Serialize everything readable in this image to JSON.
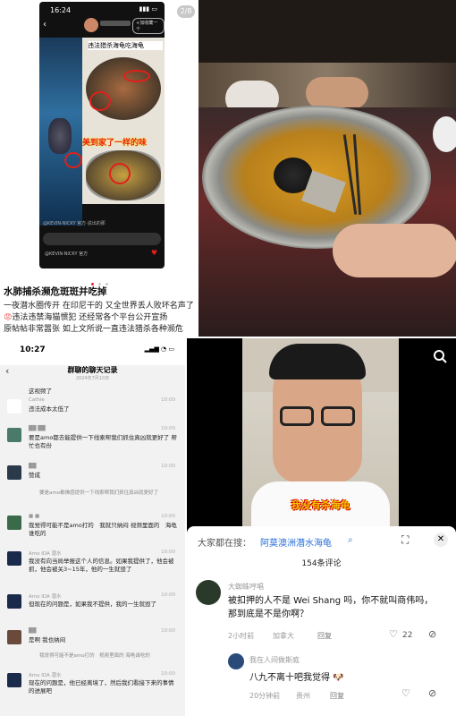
{
  "panel_a": {
    "status_time": "16:24",
    "page_indicator": "2/8",
    "post_header_tag": "+加收藏一个",
    "overlay_title": "违法猎杀海龟吃海龟",
    "overlay_caption": "美到家了一样的味",
    "username": "@KEVIN·NICKY 官方·说出的那",
    "username2": "@KEVIN·NICKY 官方",
    "article_title": "水肺捕杀濒危斑斑并吃掉",
    "article_body_1": "一夜潜水圈传开 在印尼干的 又全世界丢人败坏名声了",
    "article_body_2": "违法违禁海猫惯犯 还经常各个平台公开宣扬",
    "article_body_3": "原帖帖非常嚣张 如上文所说一直违法猎杀各种濒危"
  },
  "panel_c": {
    "time": "10:27",
    "nav_title": "群聊的聊天记录",
    "nav_subtitle": "2024年7月10日",
    "messages": [
      {
        "name": "",
        "time": "",
        "text": "这视频了"
      },
      {
        "name": "Cathie",
        "time": "10:00",
        "text": "违法成本太低了"
      },
      {
        "name": "",
        "time": "10:00",
        "text": "要是amo都去能提供一下线索帮我们抓住真凶就更好了 帮忙也有份"
      },
      {
        "name": "",
        "time": "10:00",
        "text": "赞成"
      },
      {
        "name": "",
        "time": "10:00",
        "text": "要是amo都佛感提供一下线索帮我们抓住真凶就更好了"
      },
      {
        "name": "",
        "time": "10:00",
        "text": "我觉得可能不是amo打的　我就只纳闷 视频里面的　海龟谁吃的"
      },
      {
        "name": "Amo IDA 潜水",
        "time": "10:00",
        "text": "我没有向当局举报这个人的信息。如果我提供了，他会被抓，他会被关3~15年，他的一生就毁了"
      },
      {
        "name": "Amo IDA 潜水",
        "time": "10:00",
        "text": "但现在的问题是，如果我不提供，我的一生就毁了"
      },
      {
        "name": "",
        "time": "10:00",
        "text": "是啊 我也纳闷"
      },
      {
        "name": "",
        "time": "10:00",
        "text": "我觉得可能不是amo打的　视频里面的 海龟谁吃的"
      },
      {
        "name": "Amo IDA 潜水",
        "time": "10:00",
        "text": "现在的问题是，他已经离境了，然后我们看接下来的事情的进展吧"
      }
    ]
  },
  "panel_d": {
    "video_caption": "我没有杀海龟",
    "search_prompt": "大家都在搜：",
    "search_term": "阿莫澳洲潜水海龟",
    "comment_count": "154条评论",
    "comments": [
      {
        "user": "大蜘蛛哼唱",
        "text": "被扣押的人不是 Wei Shang 吗，你不就叫商伟吗，那到底是不是你啊？",
        "time": "2小时前",
        "location": "加拿大",
        "reply": "回复",
        "likes": "22"
      },
      {
        "user": "我在人间做斯庭",
        "text": "八九不离十吧我觉得",
        "time": "20分钟前",
        "location": "贵州",
        "reply": "回复",
        "likes": ""
      }
    ]
  }
}
